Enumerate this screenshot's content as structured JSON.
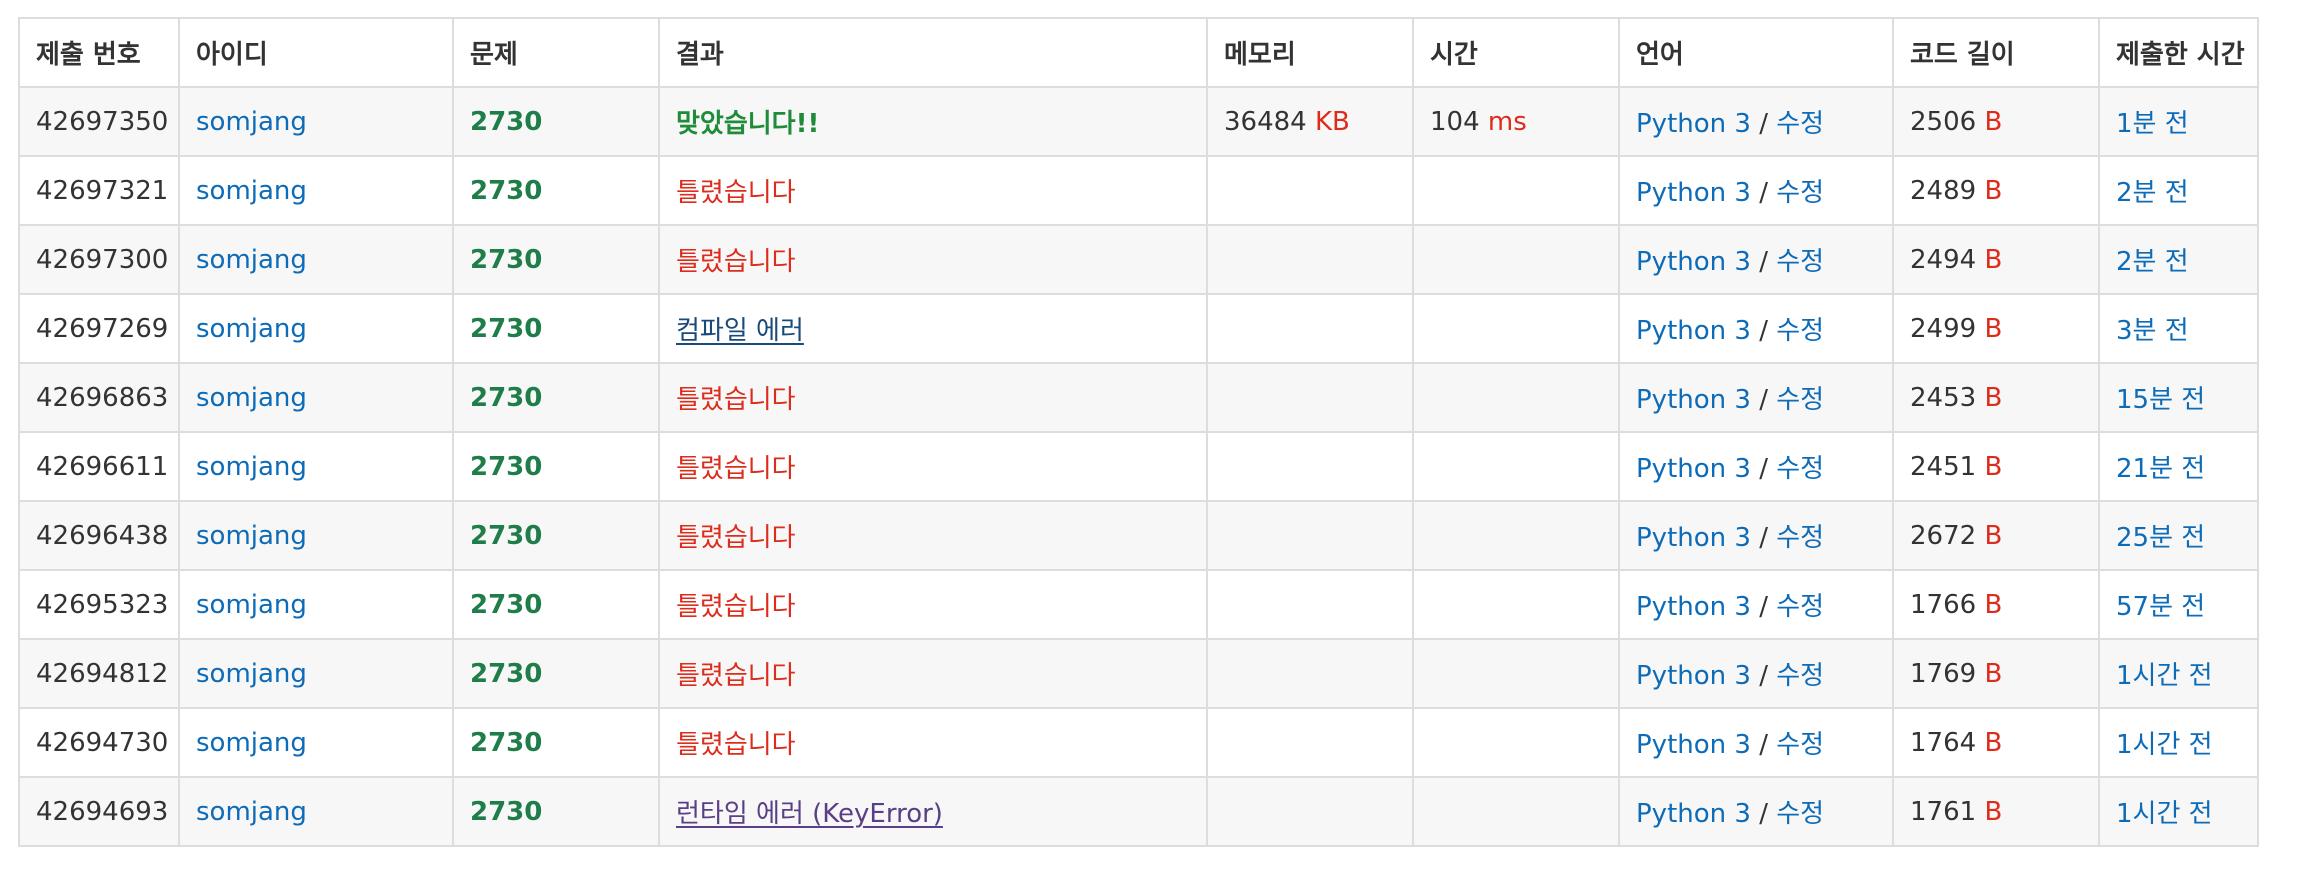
{
  "headers": {
    "submission_id": "제출 번호",
    "user_id": "아이디",
    "problem": "문제",
    "result": "결과",
    "memory": "메모리",
    "time": "시간",
    "language": "언어",
    "code_length": "코드 길이",
    "submitted_at": "제출한 시간"
  },
  "common": {
    "user": "somjang",
    "problem": "2730",
    "language": "Python 3",
    "slash": "/",
    "edit": "수정",
    "memory_unit": "KB",
    "time_unit": "ms",
    "length_unit": "B"
  },
  "rows": [
    {
      "id": "42697350",
      "result": "맞았습니다!!",
      "memory": "36484",
      "time": "104",
      "length": "2506",
      "ago": "1분 전"
    },
    {
      "id": "42697321",
      "result": "틀렸습니다",
      "memory": "",
      "time": "",
      "length": "2489",
      "ago": "2분 전"
    },
    {
      "id": "42697300",
      "result": "틀렸습니다",
      "memory": "",
      "time": "",
      "length": "2494",
      "ago": "2분 전"
    },
    {
      "id": "42697269",
      "result": "컴파일 에러",
      "memory": "",
      "time": "",
      "length": "2499",
      "ago": "3분 전"
    },
    {
      "id": "42696863",
      "result": "틀렸습니다",
      "memory": "",
      "time": "",
      "length": "2453",
      "ago": "15분 전"
    },
    {
      "id": "42696611",
      "result": "틀렸습니다",
      "memory": "",
      "time": "",
      "length": "2451",
      "ago": "21분 전"
    },
    {
      "id": "42696438",
      "result": "틀렸습니다",
      "memory": "",
      "time": "",
      "length": "2672",
      "ago": "25분 전"
    },
    {
      "id": "42695323",
      "result": "틀렸습니다",
      "memory": "",
      "time": "",
      "length": "1766",
      "ago": "57분 전"
    },
    {
      "id": "42694812",
      "result": "틀렸습니다",
      "memory": "",
      "time": "",
      "length": "1769",
      "ago": "1시간 전"
    },
    {
      "id": "42694730",
      "result": "틀렸습니다",
      "memory": "",
      "time": "",
      "length": "1764",
      "ago": "1시간 전"
    },
    {
      "id": "42694693",
      "result": "런타임 에러 (KeyError)",
      "memory": "",
      "time": "",
      "length": "1761",
      "ago": "1시간 전"
    }
  ],
  "colors": {
    "link": "#0d6bb8",
    "problem": "#1f7d4a",
    "accepted": "#1f8c3a",
    "wrong": "#dd2c1b",
    "compile_error": "#1a4a7a",
    "runtime_error": "#5b3f86",
    "unit": "#dd2c1b"
  }
}
